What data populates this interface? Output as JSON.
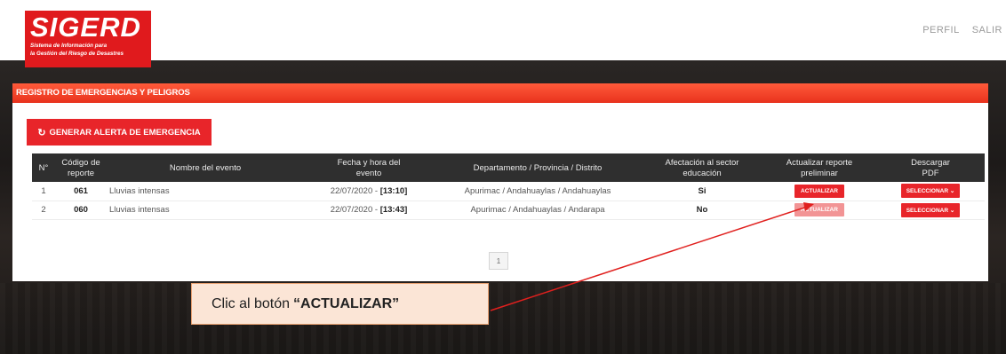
{
  "app": {
    "logo_title": "SIGERD",
    "logo_subtitle_1": "Sistema de Información para",
    "logo_subtitle_2": "la Gestión del Riesgo de Desastres"
  },
  "nav": {
    "profile": "PERFIL",
    "logout": "SALIR"
  },
  "panel": {
    "title": "REGISTRO DE EMERGENCIAS Y PELIGROS",
    "alert_button": "GENERAR ALERTA DE EMERGENCIA",
    "alert_icon": "refresh-icon"
  },
  "table": {
    "headers": {
      "num": "N°",
      "code_1": "Código de",
      "code_2": "reporte",
      "event_name": "Nombre del evento",
      "datetime_1": "Fecha y hora del",
      "datetime_2": "evento",
      "location": "Departamento / Provincia / Distrito",
      "affect_1": "Afectación al sector",
      "affect_2": "educación",
      "update_1": "Actualizar reporte",
      "update_2": "preliminar",
      "download_1": "Descargar",
      "download_2": "PDF"
    },
    "rows": [
      {
        "num": "1",
        "code": "061",
        "event": "Lluvias intensas",
        "date": "22/07/2020 - ",
        "time": "[13:10]",
        "location": "Apurimac / Andahuaylas / Andahuaylas",
        "affect": "Si",
        "update_btn": "ACTUALIZAR",
        "download_btn": "SELECCIONAR ⌄"
      },
      {
        "num": "2",
        "code": "060",
        "event": "Lluvias intensas",
        "date": "22/07/2020 - ",
        "time": "[13:43]",
        "location": "Apurimac / Andahuaylas / Andarapa",
        "affect": "No",
        "update_btn": "ACTUALIZAR",
        "download_btn": "SELECCIONAR ⌄"
      }
    ]
  },
  "pagination": {
    "current_page": "1"
  },
  "callout": {
    "prefix": "Clic al botón",
    "target": "“ACTUALIZAR”"
  },
  "colors": {
    "brand_red": "#e01a1d",
    "header_dark": "#2f2f2f",
    "callout_bg": "#fbe5d6",
    "arrow": "#e0201e"
  }
}
